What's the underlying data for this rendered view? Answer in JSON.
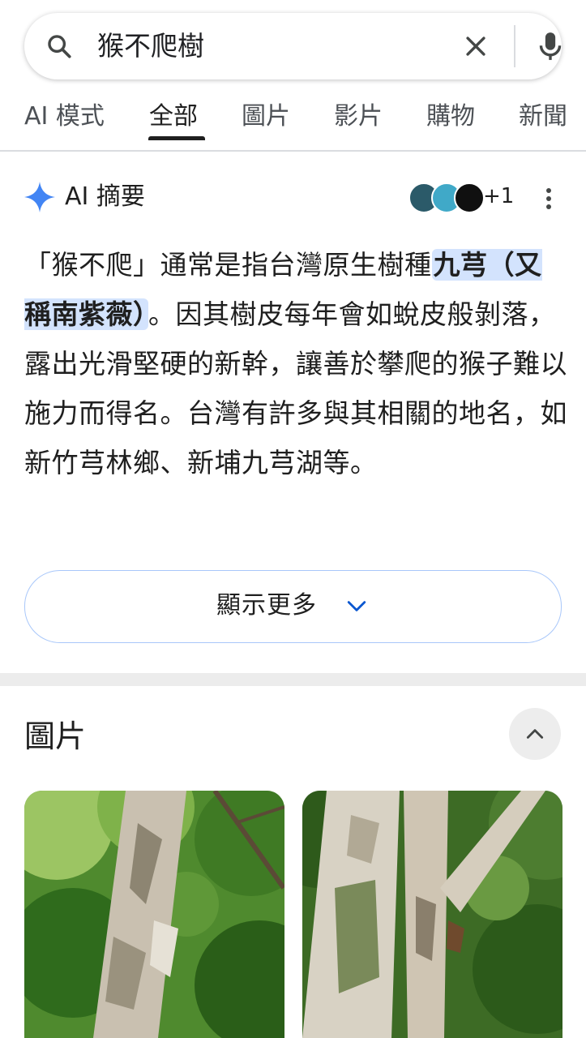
{
  "search": {
    "query": "猴不爬樹"
  },
  "tabs": [
    {
      "label": "AI 模式"
    },
    {
      "label": "全部",
      "active": true
    },
    {
      "label": "圖片"
    },
    {
      "label": "影片"
    },
    {
      "label": "購物"
    },
    {
      "label": "新聞"
    }
  ],
  "ai_overview": {
    "title": "AI 摘要",
    "sources_more": "+1",
    "text_part1": "「猴不爬」通常是指台灣原生樹種",
    "highlight": "九芎（又稱南紫薇）",
    "text_part2": "。因其樹皮每年會如蛻皮般剝落，露出光滑堅硬的新幹，讓善於攀爬的猴子難以施力而得名。台灣有許多與其相關的地名，如新竹芎林鄉、新埔九芎湖等。",
    "show_more": "顯示更多"
  },
  "images": {
    "title": "圖片"
  },
  "colors": {
    "highlight_bg": "#d3e3fd",
    "show_more_border": "#a8c7fa",
    "spark_blue": "#4285f4"
  }
}
